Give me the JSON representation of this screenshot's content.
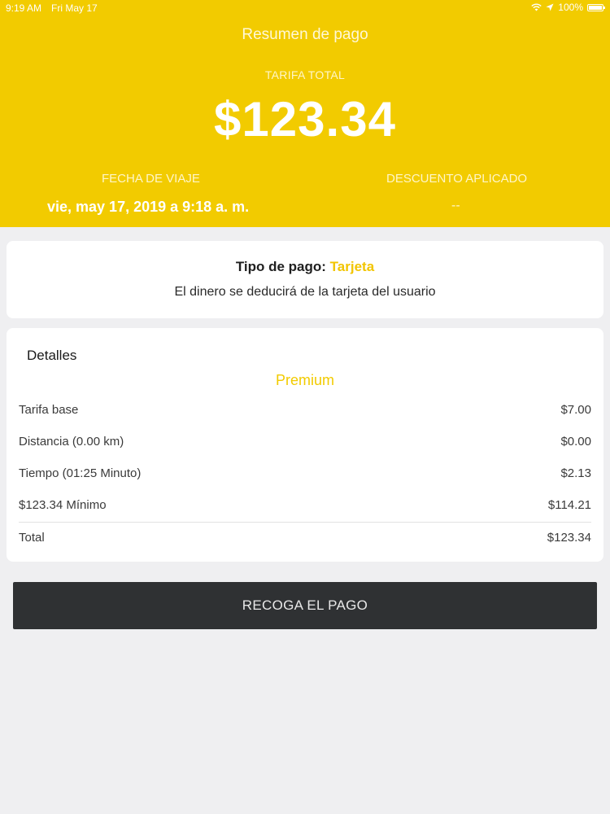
{
  "status_bar": {
    "time": "9:19 AM",
    "date": "Fri May 17",
    "battery_percent": "100%",
    "icons": [
      "wifi-icon",
      "location-arrow-icon",
      "battery-icon"
    ]
  },
  "header": {
    "title": "Resumen de pago",
    "fare_label": "TARIFA TOTAL",
    "fare_amount": "$123.34",
    "trip_date_label": "FECHA DE VIAJE",
    "trip_date_value": "vie, may 17, 2019 a 9:18 a. m.",
    "discount_label": "DESCUENTO APLICADO",
    "discount_value": "--"
  },
  "payment": {
    "type_label": "Tipo de pago:",
    "type_value": "Tarjeta",
    "description": "El dinero se deducirá de la tarjeta del usuario"
  },
  "details": {
    "title": "Detalles",
    "service_class": "Premium",
    "rows": [
      {
        "label": "Tarifa base",
        "value": "$7.00"
      },
      {
        "label": "Distancia (0.00 km)",
        "value": "$0.00"
      },
      {
        "label": "Tiempo (01:25 Minuto)",
        "value": "$2.13"
      },
      {
        "label": "$123.34 Mínimo",
        "value": "$114.21"
      },
      {
        "label": "Total",
        "value": "$123.34"
      }
    ]
  },
  "actions": {
    "collect_label": "RECOGA EL PAGO"
  },
  "colors": {
    "brand_yellow": "#f2cb00",
    "button_dark": "#2f3133",
    "background": "#efeff1"
  }
}
